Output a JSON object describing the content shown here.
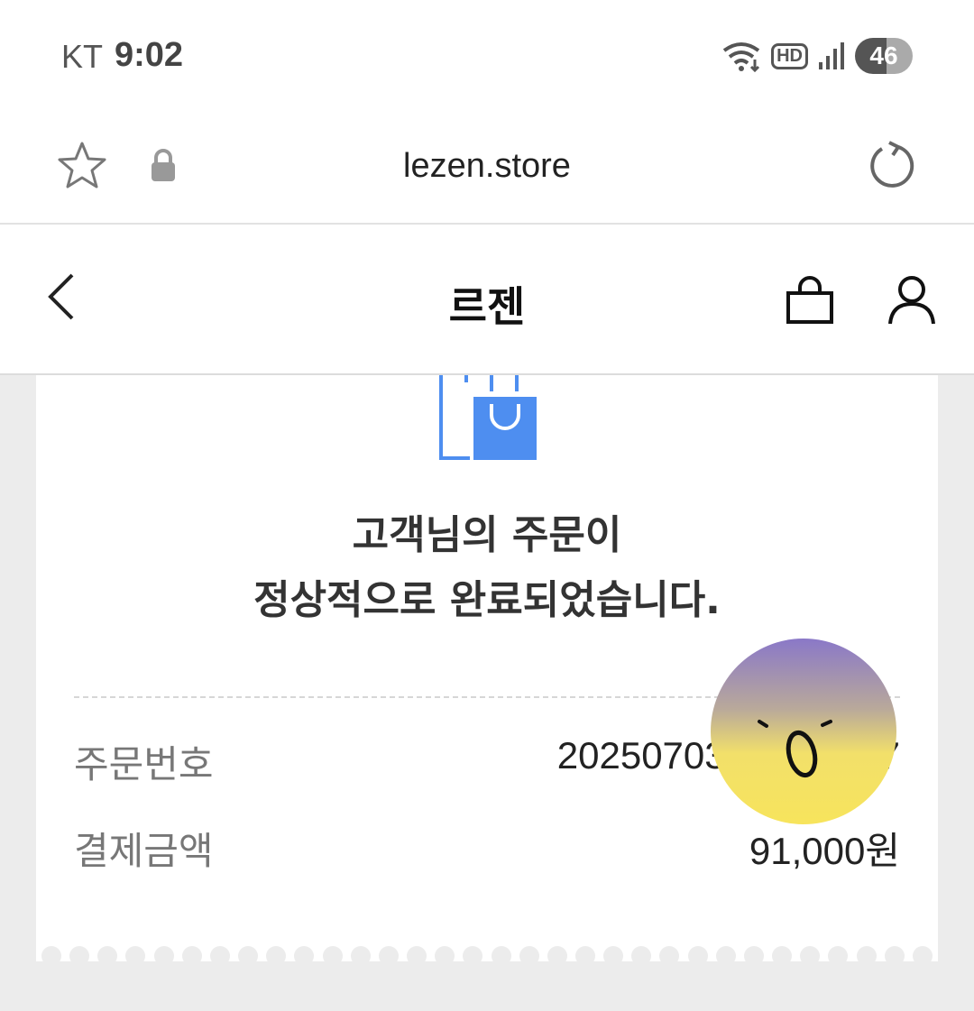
{
  "status_bar": {
    "carrier": "KT",
    "time": "9:02",
    "network_badge": "HD",
    "battery": "46"
  },
  "browser": {
    "url": "lezen.store"
  },
  "site_header": {
    "title": "르젠"
  },
  "order_complete": {
    "message_line1": "고객님의 주문이",
    "message_line2": "정상적으로 완료되었습니다.",
    "order_number_label": "주문번호",
    "order_number_value": "20250703",
    "order_number_suffix": "7",
    "amount_label": "결제금액",
    "amount_value": "91,000원"
  },
  "colors": {
    "accent_blue": "#4e8ef0"
  }
}
